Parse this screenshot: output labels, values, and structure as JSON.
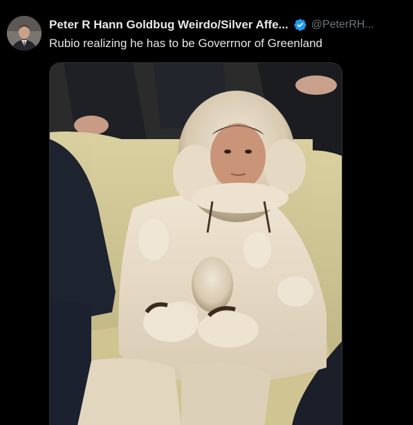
{
  "post": {
    "display_name": "Peter R Hann Goldbug Weirdo/Silver Affe...",
    "handle": "@PeterRH...",
    "text": "Rubio realizing he has to be Goverrnor of Greenland",
    "avatar_icon": "user-avatar",
    "verified_icon": "verified-badge-icon"
  },
  "colors": {
    "background": "#000000",
    "text_primary": "#e7e9ea",
    "text_secondary": "#71767b",
    "verified_blue": "#1d9bf0"
  }
}
